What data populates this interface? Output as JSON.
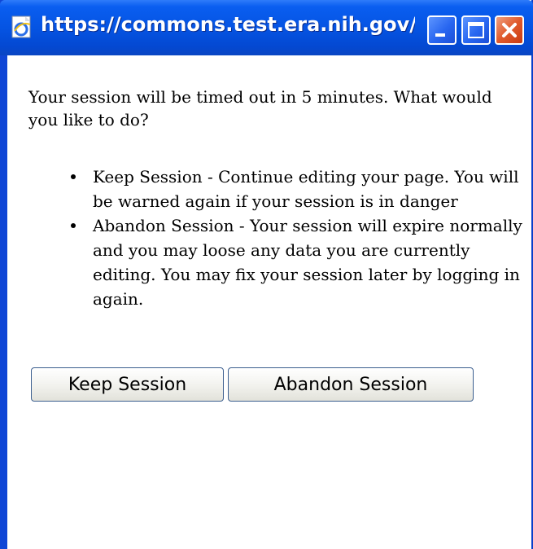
{
  "window": {
    "title": "https://commons.test.era.nih.gov/...",
    "controls": {
      "minimize": "minimize",
      "maximize": "maximize",
      "close": "close"
    }
  },
  "dialog": {
    "message": "Your session will be timed out in 5 minutes. What would you like to do?",
    "options": [
      "Keep Session - Continue editing your page. You will be warned again if your session is in danger",
      "Abandon Session - Your session will expire normally and you may loose any data you are currently editing. You may fix your session later by logging in again."
    ],
    "buttons": {
      "keep": "Keep Session",
      "abandon": "Abandon Session"
    }
  },
  "icons": [
    "ie-page-icon",
    "minimize-icon",
    "maximize-icon",
    "close-icon",
    "bullet-icon"
  ],
  "colors": {
    "titlebar": "#0554e3",
    "close_button": "#e05a2c",
    "window_background": "#ffffff"
  }
}
